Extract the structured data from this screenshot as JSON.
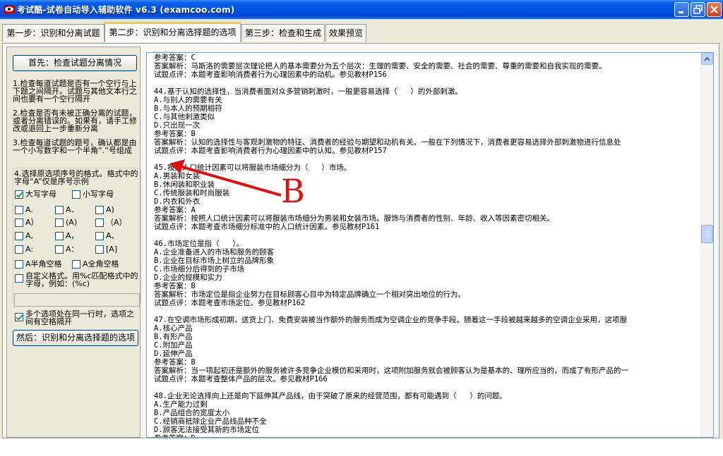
{
  "window": {
    "title": "考试酷-试卷自动导入辅助软件 v6.3 (examcoo.com)",
    "icon": "eye-icon"
  },
  "tabs": [
    {
      "label": "第一步：识别和分离试题"
    },
    {
      "label": "第二步：识别和分离选择题的选项"
    },
    {
      "label": "第三步：检查和生成"
    },
    {
      "label": "效果预览"
    }
  ],
  "left_panel": {
    "check_button": "首先：检查试题分离情况",
    "instructions": [
      "1.检查每道试题是否有一个空行与上下题之间隔开。试题与其他文本行之间也要有一个空行隔开",
      "2.检查是否有未被正确分离的试题，或者分离错误的。如果有，请手工修改或退回上一步重新分离",
      "3.检查每道试题的题号，确认都是由一个小写数字和一个半角“.”号组成"
    ],
    "format_note": "4.选择原选项序号的格式。格式中的字母“A”仅是序号示例",
    "case_options": [
      {
        "label": "大写字母",
        "checked": true
      },
      {
        "label": "小写字母",
        "checked": false
      }
    ],
    "format_options": [
      "A.",
      "A．",
      "A)",
      "A）",
      "(A)",
      "（A）",
      "A,",
      "A，",
      "A、",
      "A:",
      "A：",
      "[A]"
    ],
    "space_options": [
      {
        "label": "A半角空格",
        "checked": false
      },
      {
        "label": "A全角空格",
        "checked": false
      }
    ],
    "custom_format": {
      "label": "自定义格式。用%c匹配格式中的字母，例如：(%c)",
      "checked": false,
      "value": ""
    },
    "multi_option": {
      "label": "多个选项处在同一行时，选项之间有空格隔开",
      "checked": true
    },
    "next_button": "然后：识别和分离选择题的选项"
  },
  "document_lines": [
    "参考答案：C",
    "答案解析：马斯洛的需要层次理论把人的基本需要分为五个层次：生理的需要、安全的需要、社会的需要、尊重的需要和自我实现的需要。",
    "试题点评：本题考查影响消费者行为心理因素中的动机。参见教材P156",
    "",
    "44.基于认知的选择性，当消费者面对众多营销刺激时，一般更容易选择（   ）的外部刺激。",
    "A.与别人的需要有关",
    "B.与本人的预期相符",
    "C.与其他刺激类似",
    "D.只出现一次",
    "参考答案：B",
    "答案解析：认知的选择性与客观刺激物的特征、消费者的经验与期望和动机有关。一般在下列情况下，消费者更容易选择外部刺激物进行信息处",
    "试题点评：本题考查影响消费者行为心理因素中的认知。参见教材P157",
    "",
    "45.按照人口统计因素可以将服装市场细分为（   ）市场。",
    "A.男装和女装",
    "B.休闲装和职业装",
    "C.传统服装和时尚服装",
    "D.内衣和外衣",
    "参考答案：A",
    "答案解析：按照人口统计因素可以将服装市场细分为男装和女装市场。服饰与消费者的性别、年龄、收入等因素密切相关。",
    "试题点评：本题考查市场细分标准中的人口统计因素。参见教材P161",
    "",
    "46.市场定位是指（   ）。",
    "A.企业准备进入的市场和服务的顾客",
    "B.企业在目标市场上树立的品牌形象",
    "C.市场细分后得到的子市场",
    "D.企业的规模和实力",
    "参考答案：B",
    "答案解析：市场定位是指企业努力在目标顾客心目中为特定品牌确立一个相对突出地位的行为。",
    "试题点评：本题考查市场定位。参见教材P162",
    "",
    "47.在空调市场形成初期，送货上门、免费安装被当作额外的服务而成为空调企业的竞争手段。随着这一手段被越来越多的空调企业采用，这项服",
    "A.核心产品",
    "B.有形产品",
    "C.附加产品",
    "D.延伸产品",
    "参考答案：B",
    "答案解析：当一项起初还是额外的服务被许多竞争企业模仿和采用时，这项附加服务就会被顾客认为是基本的、理所应当的，而成了有形产品的一",
    "试题点评：本题考查整体产品的层次。参见教材P166",
    "",
    "48.企业无论选择向上还是向下延伸其产品线，由于突破了原来的经营范围，都有可能遇到（   ）的问题。",
    "A.生产能力过剩",
    "B.产品组合的宽度太小",
    "C.经销商抵除企业产品线品种不全",
    "D.顾客无法接受其新的市场定位",
    "参考答案：D"
  ],
  "annotation": {
    "label": "B",
    "color": "#e01010"
  }
}
